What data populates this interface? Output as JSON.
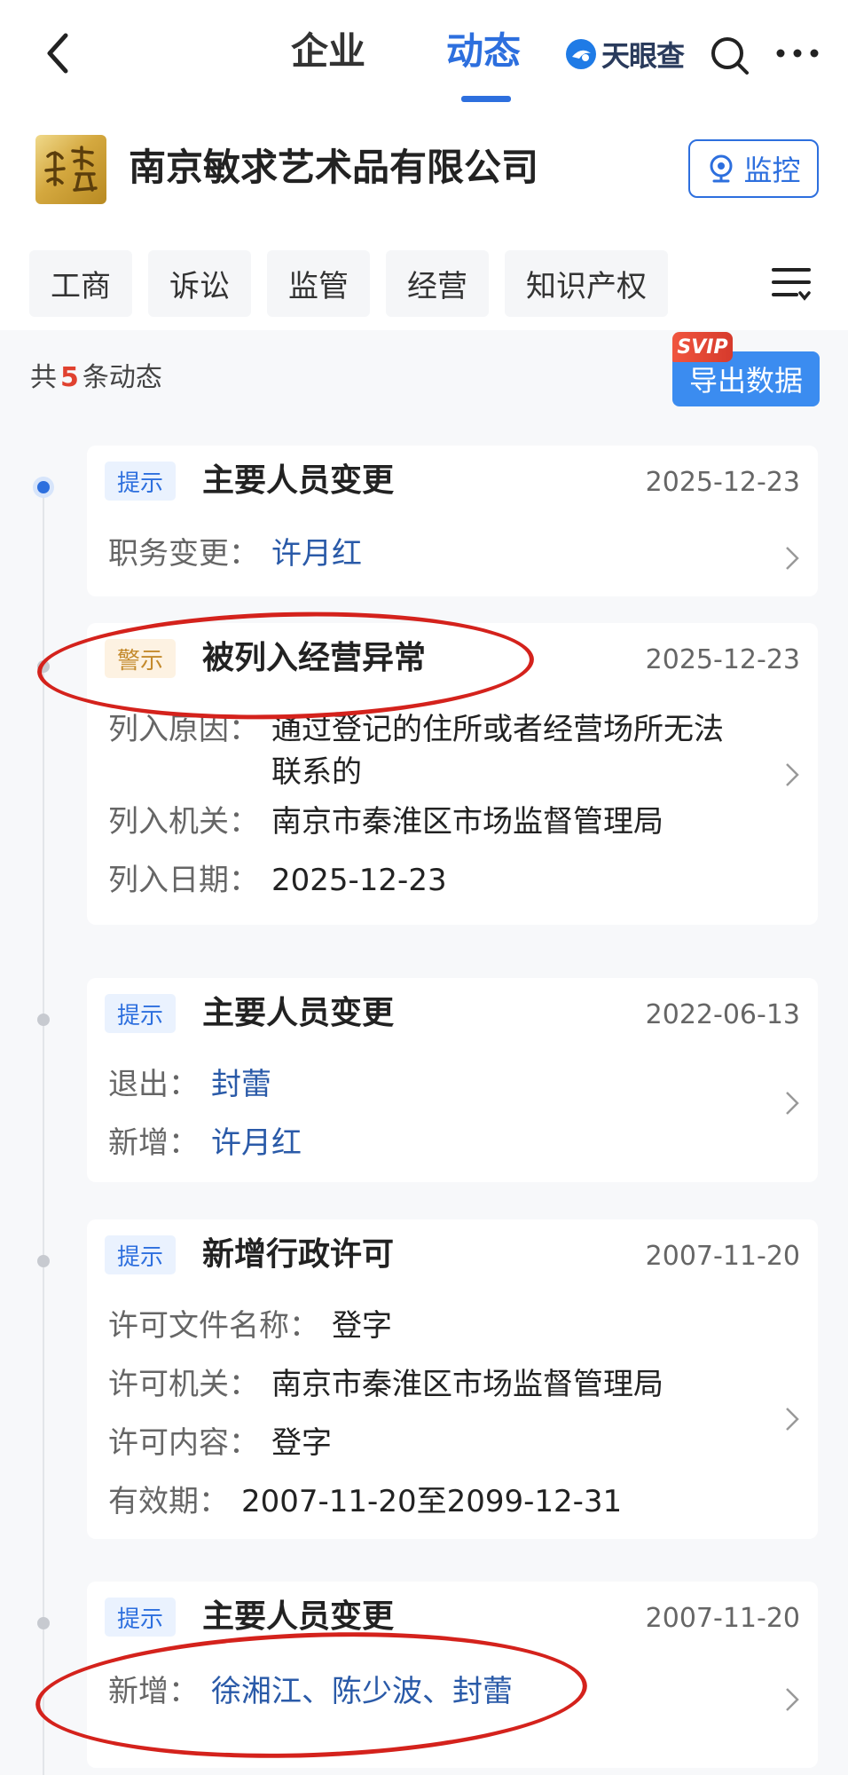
{
  "nav": {
    "tabs": [
      {
        "label": "企业",
        "active": false
      },
      {
        "label": "动态",
        "active": true
      }
    ],
    "brand": "天眼查",
    "accent": "#2d6fde"
  },
  "company": {
    "name": "南京敏求艺术品有限公司",
    "monitor_label": "监控"
  },
  "filters": [
    "工商",
    "诉讼",
    "监管",
    "经营",
    "知识产权"
  ],
  "summary": {
    "prefix": "共",
    "count": "5",
    "suffix": "条动态",
    "export_label": "导出数据",
    "svip_badge": "SVIP"
  },
  "events": [
    {
      "tag": "提示",
      "tag_type": "info",
      "title": "主要人员变更",
      "date": "2025-12-23",
      "rows": [
        {
          "label": "职务变更：",
          "value": "许月红",
          "link": true
        }
      ]
    },
    {
      "tag": "警示",
      "tag_type": "warn",
      "title": "被列入经营异常",
      "date": "2025-12-23",
      "rows": [
        {
          "label": "列入原因：",
          "value": "通过登记的住所或者经营场所无法联系的"
        },
        {
          "label": "列入机关：",
          "value": "南京市秦淮区市场监督管理局"
        },
        {
          "label": "列入日期：",
          "value": "2025-12-23"
        }
      ]
    },
    {
      "tag": "提示",
      "tag_type": "info",
      "title": "主要人员变更",
      "date": "2022-06-13",
      "rows": [
        {
          "label": "退出：",
          "value": "封蕾",
          "link": true
        },
        {
          "label": "新增：",
          "value": "许月红",
          "link": true
        }
      ]
    },
    {
      "tag": "提示",
      "tag_type": "info",
      "title": "新增行政许可",
      "date": "2007-11-20",
      "rows": [
        {
          "label": "许可文件名称：",
          "value": "登字"
        },
        {
          "label": "许可机关：",
          "value": "南京市秦淮区市场监督管理局"
        },
        {
          "label": "许可内容：",
          "value": "登字"
        },
        {
          "label": "有效期：",
          "value": "2007-11-20至2099-12-31"
        }
      ]
    },
    {
      "tag": "提示",
      "tag_type": "info",
      "title": "主要人员变更",
      "date": "2007-11-20",
      "rows": [
        {
          "label": "新增：",
          "value": "徐湘江、陈少波、封蕾",
          "link": true
        }
      ]
    }
  ]
}
